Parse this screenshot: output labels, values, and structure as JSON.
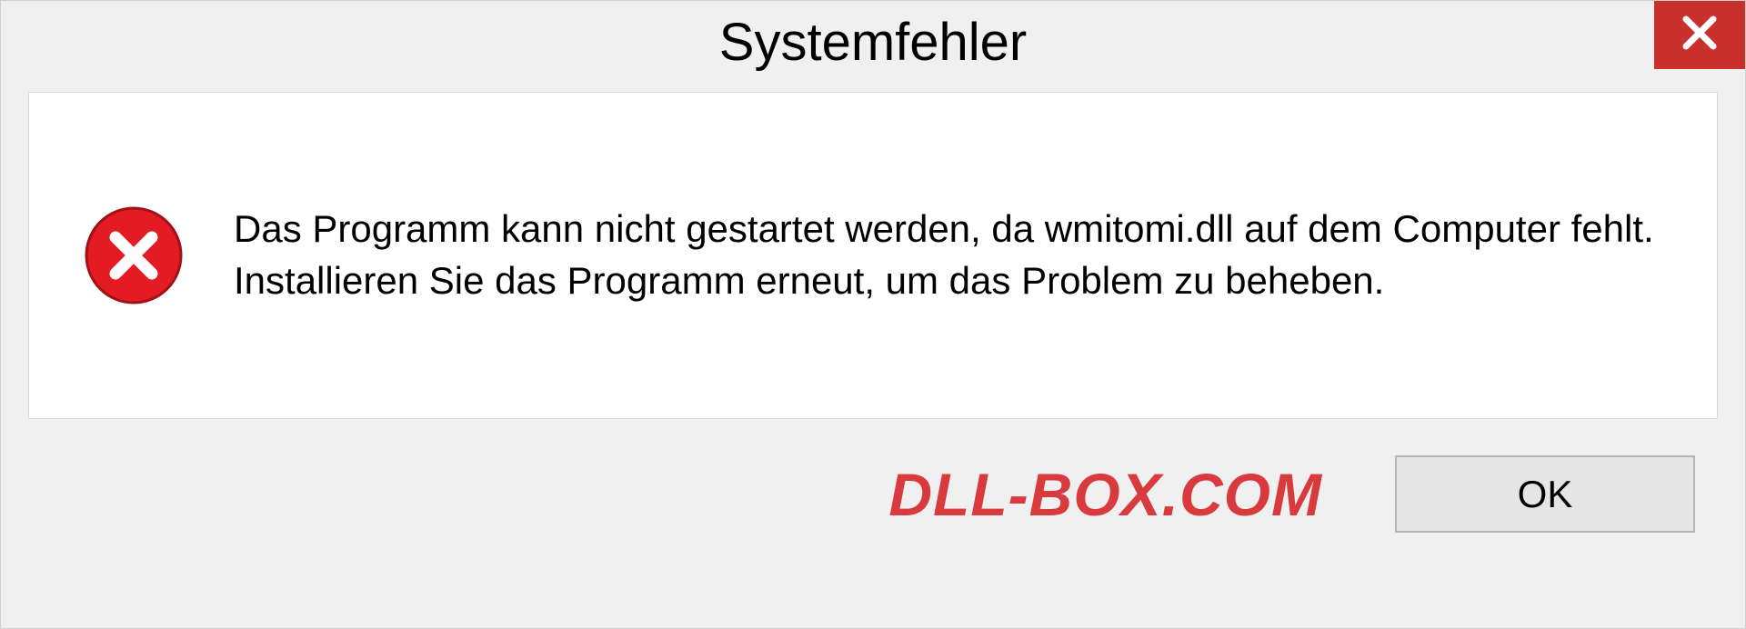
{
  "dialog": {
    "title": "Systemfehler",
    "message": "Das Programm kann nicht gestartet werden, da wmitomi.dll auf dem Computer fehlt. Installieren Sie das Programm erneut, um das Problem zu beheben.",
    "ok_label": "OK"
  },
  "watermark": "DLL-BOX.COM",
  "colors": {
    "close_button": "#c9302c",
    "error_icon": "#e31b23",
    "watermark": "#d93a3e"
  }
}
